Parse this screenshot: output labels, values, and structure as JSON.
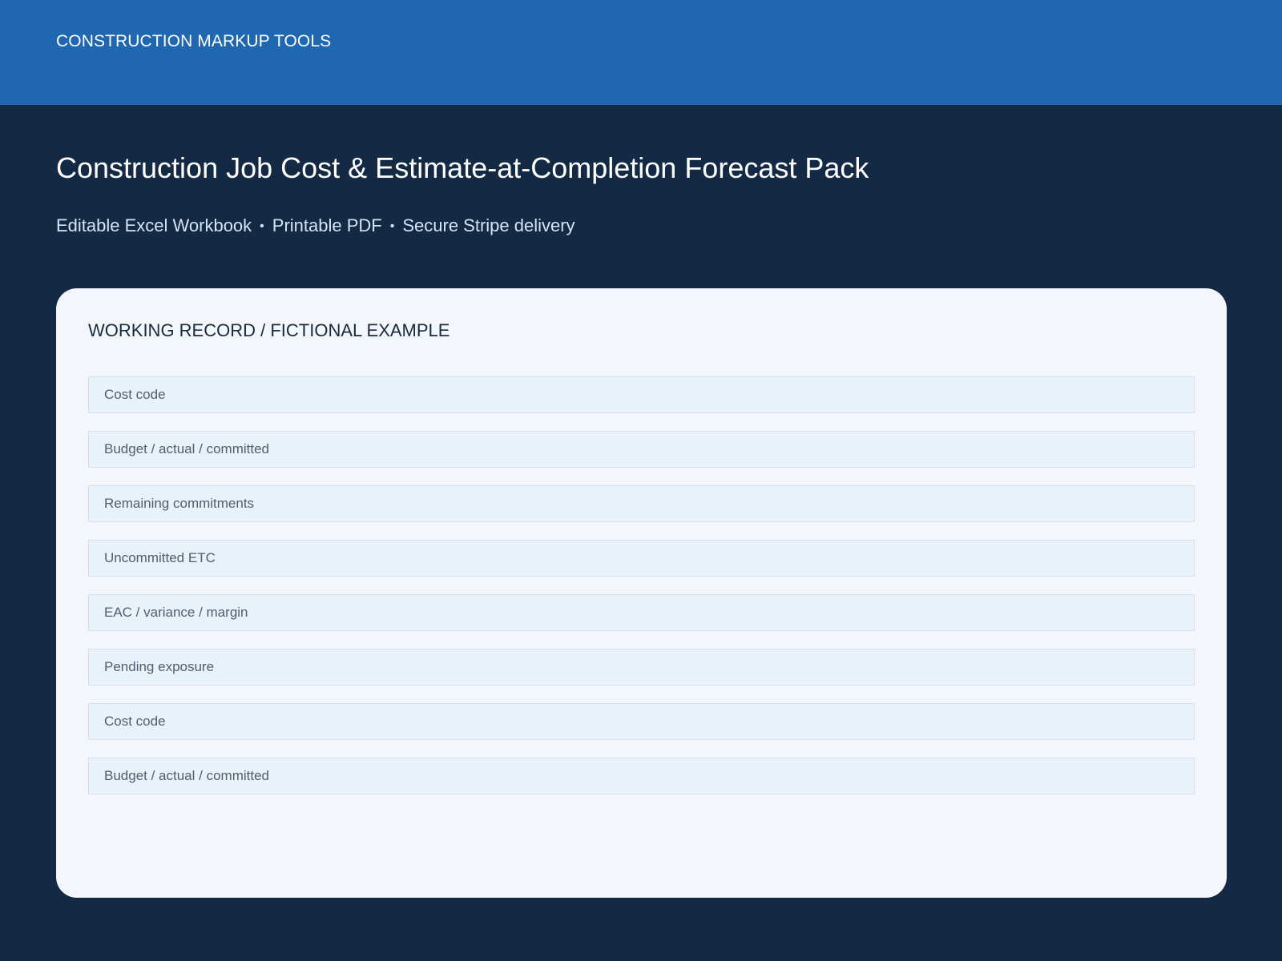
{
  "header": {
    "brand": "CONSTRUCTION MARKUP TOOLS"
  },
  "hero": {
    "title": "Construction Job Cost & Estimate-at-Completion Forecast Pack",
    "features": [
      "Editable Excel Workbook",
      "Printable PDF",
      "Secure Stripe delivery"
    ],
    "separator": "•"
  },
  "card": {
    "title": "WORKING RECORD / FICTIONAL EXAMPLE",
    "rows": [
      "Cost code",
      "Budget / actual / committed",
      "Remaining commitments",
      "Uncommitted ETC",
      "EAC / variance / margin",
      "Pending exposure",
      "Cost code",
      "Budget / actual / committed"
    ]
  },
  "colors": {
    "header_bg": "#1f67b0",
    "page_bg": "#142a44",
    "card_bg": "#f3f7fb",
    "row_bg": "#e9f1fa"
  }
}
